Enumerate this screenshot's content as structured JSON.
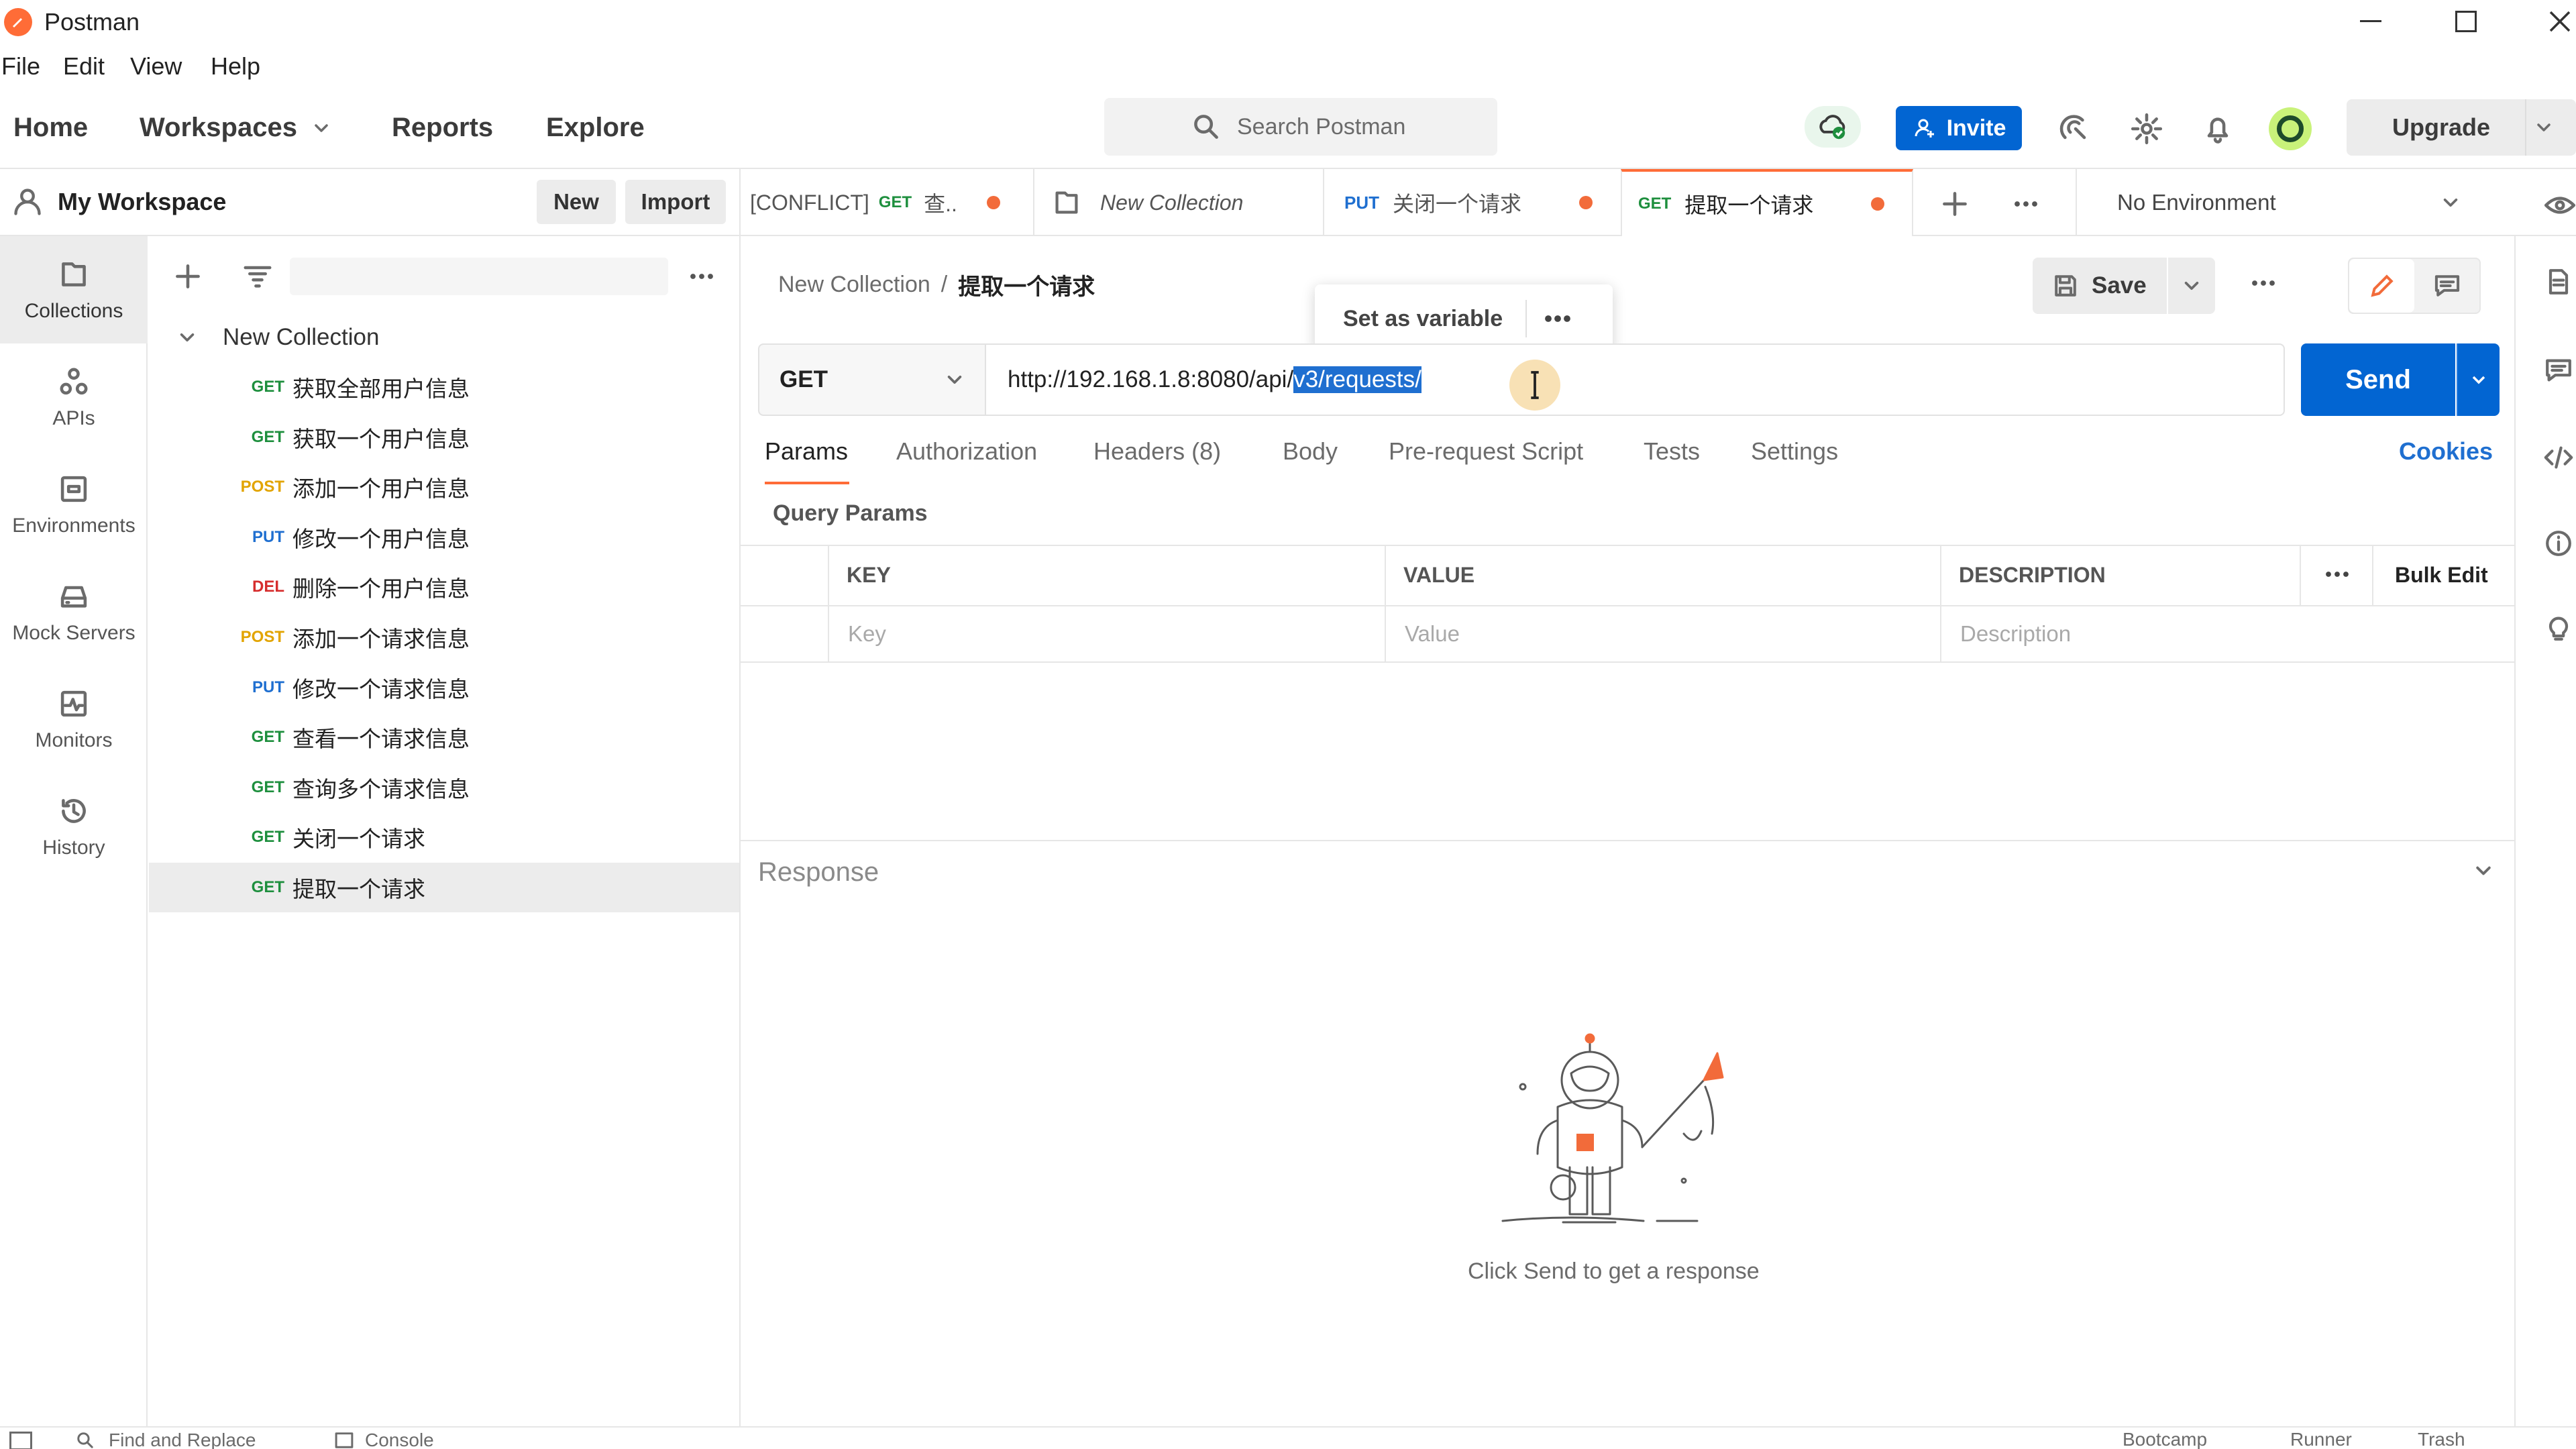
{
  "app": {
    "title": "Postman",
    "accent": "#ff6c37"
  },
  "menu": [
    "File",
    "Edit",
    "View",
    "Help"
  ],
  "header": {
    "nav": [
      "Home",
      "Workspaces",
      "Reports",
      "Explore"
    ],
    "search_placeholder": "Search Postman",
    "invite_label": "Invite",
    "upgrade_label": "Upgrade"
  },
  "sidebar": {
    "workspace_name": "My Workspace",
    "new_label": "New",
    "import_label": "Import",
    "rail": [
      "Collections",
      "APIs",
      "Environments",
      "Mock Servers",
      "Monitors",
      "History"
    ],
    "collection_name": "New Collection",
    "requests": [
      {
        "method": "GET",
        "name": "获取全部用户信息",
        "color": "#1e8f3e"
      },
      {
        "method": "GET",
        "name": "获取一个用户信息",
        "color": "#1e8f3e"
      },
      {
        "method": "POST",
        "name": "添加一个用户信息",
        "color": "#e2a400"
      },
      {
        "method": "PUT",
        "name": "修改一个用户信息",
        "color": "#1f6fd0"
      },
      {
        "method": "DEL",
        "name": "删除一个用户信息",
        "color": "#d62d2d"
      },
      {
        "method": "POST",
        "name": "添加一个请求信息",
        "color": "#e2a400"
      },
      {
        "method": "PUT",
        "name": "修改一个请求信息",
        "color": "#1f6fd0"
      },
      {
        "method": "GET",
        "name": "查看一个请求信息",
        "color": "#1e8f3e"
      },
      {
        "method": "GET",
        "name": "查询多个请求信息",
        "color": "#1e8f3e"
      },
      {
        "method": "GET",
        "name": "关闭一个请求",
        "color": "#1e8f3e"
      },
      {
        "method": "GET",
        "name": "提取一个请求",
        "color": "#1e8f3e"
      }
    ]
  },
  "tabs": [
    {
      "prefix": "[CONFLICT]",
      "method": "GET",
      "name": "查..",
      "unsaved": true
    },
    {
      "prefix": "",
      "method": "",
      "name": "New Collection",
      "unsaved": false
    },
    {
      "prefix": "",
      "method": "PUT",
      "name": "关闭一个请求",
      "unsaved": true
    },
    {
      "prefix": "",
      "method": "GET",
      "name": "提取一个请求",
      "unsaved": true
    }
  ],
  "environment": "No Environment",
  "breadcrumb": {
    "collection": "New Collection",
    "sep": "/",
    "request": "提取一个请求"
  },
  "popup": {
    "label": "Set as variable"
  },
  "save_label": "Save",
  "request": {
    "method": "GET",
    "url_prefix": "http://192.168.1.8:8080/api/",
    "url_selected": "v3/requests/",
    "send_label": "Send"
  },
  "subtabs": [
    "Params",
    "Authorization",
    "Headers (8)",
    "Body",
    "Pre-request Script",
    "Tests",
    "Settings"
  ],
  "cookies_label": "Cookies",
  "params": {
    "title": "Query Params",
    "columns": [
      "KEY",
      "VALUE",
      "DESCRIPTION"
    ],
    "bulk_edit": "Bulk Edit",
    "placeholders": [
      "Key",
      "Value",
      "Description"
    ]
  },
  "response": {
    "title": "Response",
    "hint": "Click Send to get a response"
  },
  "footer": [
    "Find and Replace",
    "Console",
    "Bootcamp",
    "Runner",
    "Trash"
  ]
}
